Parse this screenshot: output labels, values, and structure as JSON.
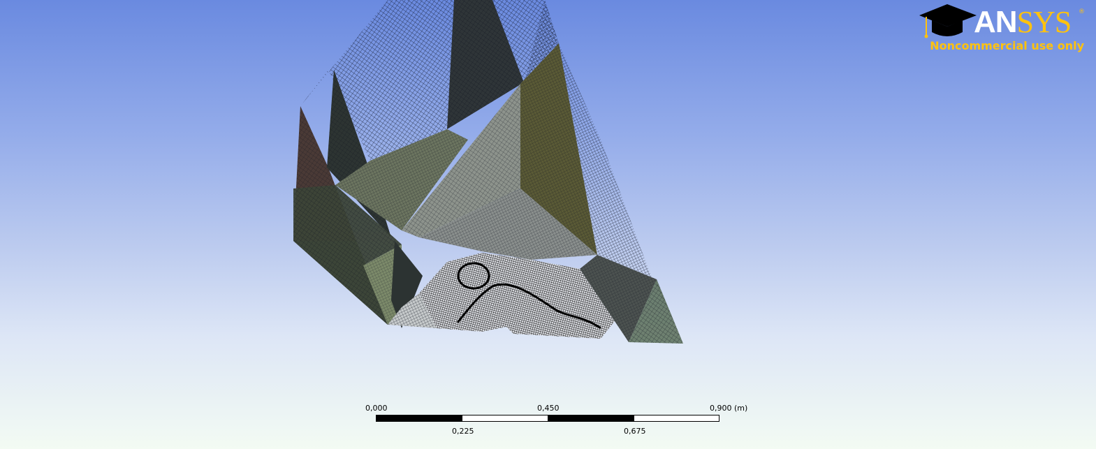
{
  "logo": {
    "brand_an": "AN",
    "brand_sys": "SYS",
    "reg_mark": "®",
    "subtitle": "Noncommercial use only",
    "accent_color": "#ffc20e",
    "icon": "mortarboard-icon"
  },
  "scale_bar": {
    "top_labels": [
      "0,000",
      "0,450",
      "0,900 (m)"
    ],
    "bottom_labels": [
      "0,225",
      "0,675"
    ]
  },
  "colors": {
    "background_top": "#6a8ae0",
    "background_bottom": "#f3fbf3",
    "mesh_line": "#0b0f1c"
  }
}
